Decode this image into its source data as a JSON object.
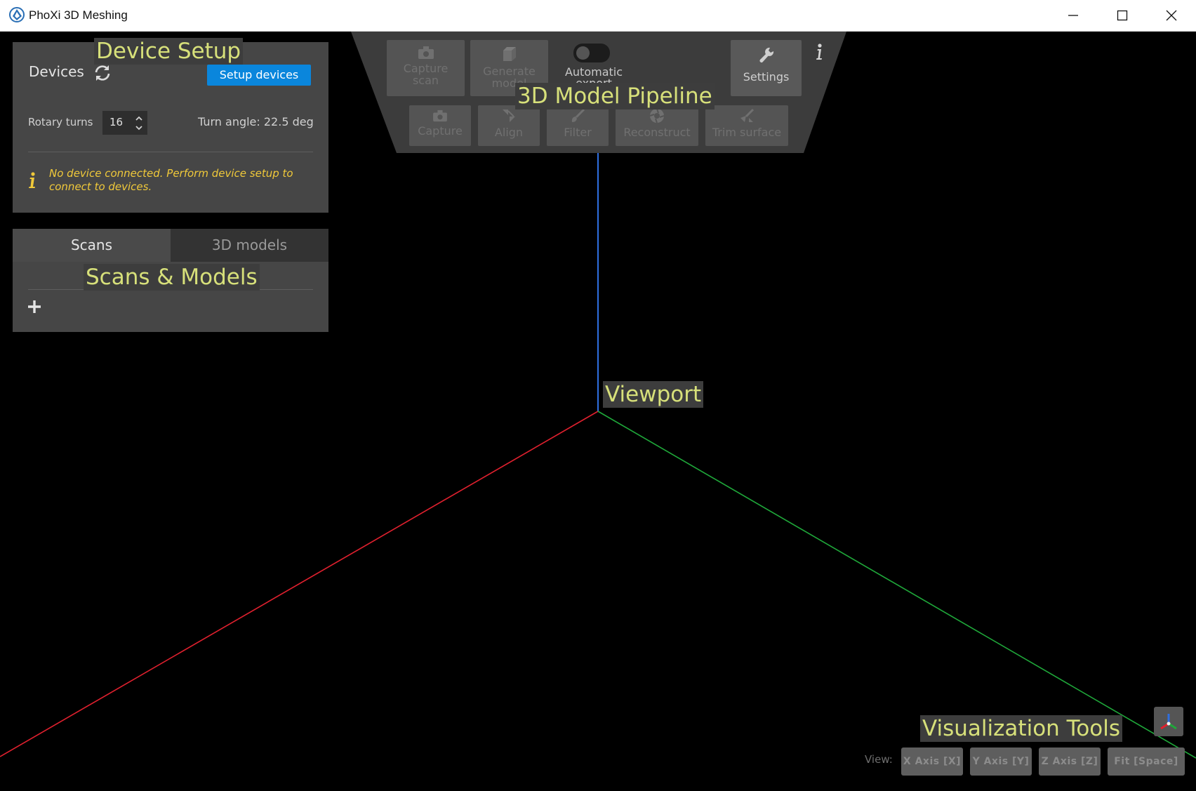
{
  "window": {
    "title": "PhoXi 3D Meshing"
  },
  "device_setup": {
    "devices_label": "Devices",
    "setup_button": "Setup devices",
    "rotary_turns_label": "Rotary turns",
    "rotary_turns_value": "16",
    "turn_angle": "Turn angle: 22.5 deg",
    "warning": "No device connected. Perform device setup to connect to devices."
  },
  "scans_panel": {
    "tabs": [
      {
        "label": "Scans",
        "active": true
      },
      {
        "label": "3D models",
        "active": false
      }
    ]
  },
  "pipeline": {
    "top_buttons": [
      {
        "label": "Capture scan",
        "icon": "camera-icon",
        "enabled": false
      },
      {
        "label": "Generate model",
        "icon": "cube-icon",
        "enabled": false
      }
    ],
    "automatic_export_label": "Automatic export",
    "automatic_export_on": false,
    "settings_label": "Settings",
    "steps": [
      {
        "label": "Capture",
        "icon": "camera-icon",
        "enabled": false
      },
      {
        "label": "Align",
        "icon": "align-icon",
        "enabled": false
      },
      {
        "label": "Filter",
        "icon": "brush-icon",
        "enabled": false
      },
      {
        "label": "Reconstruct",
        "icon": "aperture-icon",
        "enabled": false
      },
      {
        "label": "Trim surface",
        "icon": "trim-icon",
        "enabled": false
      }
    ]
  },
  "view_toolbar": {
    "view_label": "View:",
    "buttons": [
      "X Axis [X]",
      "Y Axis [Y]",
      "Z Axis [Z]",
      "Fit [Space]"
    ]
  },
  "overlay_labels": {
    "device_setup": "Device Setup",
    "pipeline": "3D Model Pipeline",
    "scans_models": "Scans & Models",
    "viewport": "Viewport",
    "visualization": "Visualization Tools"
  },
  "colors": {
    "axis_x": "#e0202e",
    "axis_y": "#1fa83a",
    "axis_z": "#2f6fe0",
    "accent": "#0a86dc",
    "warning": "#f0c93a",
    "overlay_text": "#d7e07a"
  }
}
